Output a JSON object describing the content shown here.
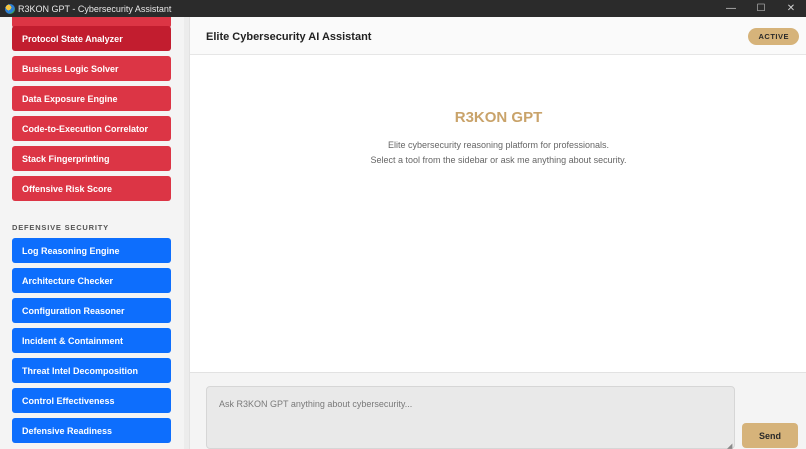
{
  "window": {
    "title": "R3KON GPT - Cybersecurity Assistant",
    "controls": {
      "minimize": "—",
      "maximize": "☐",
      "close": "✕"
    }
  },
  "sidebar": {
    "offensive_tools": [
      {
        "label": "Protocol State Analyzer"
      },
      {
        "label": "Business Logic Solver"
      },
      {
        "label": "Data Exposure Engine"
      },
      {
        "label": "Code-to-Execution Correlator"
      },
      {
        "label": "Stack Fingerprinting"
      },
      {
        "label": "Offensive Risk Score"
      }
    ],
    "defensive_section_title": "DEFENSIVE SECURITY",
    "defensive_tools": [
      {
        "label": "Log Reasoning Engine"
      },
      {
        "label": "Architecture Checker"
      },
      {
        "label": "Configuration Reasoner"
      },
      {
        "label": "Incident & Containment"
      },
      {
        "label": "Threat Intel Decomposition"
      },
      {
        "label": "Control Effectiveness"
      },
      {
        "label": "Defensive Readiness"
      }
    ],
    "colors": {
      "offensive": "#dc3545",
      "defensive": "#0d6efd"
    }
  },
  "header": {
    "title": "Elite Cybersecurity AI Assistant",
    "status_badge": "ACTIVE"
  },
  "welcome": {
    "brand": "R3KON GPT",
    "line1": "Elite cybersecurity reasoning platform for professionals.",
    "line2": "Select a tool from the sidebar or ask me anything about security."
  },
  "composer": {
    "placeholder": "Ask R3KON GPT anything about cybersecurity...",
    "value": "",
    "send_label": "Send"
  },
  "theme": {
    "accent": "#d6b37a",
    "brand_text": "#c9a36a"
  }
}
